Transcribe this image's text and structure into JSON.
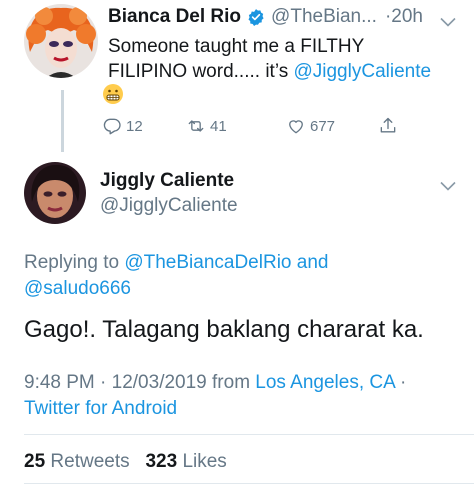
{
  "parent_tweet": {
    "name": "Bianca Del Rio",
    "handle": "@TheBian...",
    "time": "·20h",
    "text_line1": "Someone taught me a FILTHY",
    "text_line2_prefix": "FILIPINO word..... it’s ",
    "mention": "@JigglyCaliente",
    "emoji": "grimacing-face",
    "reply_count": "12",
    "retweet_count": "41",
    "like_count": "677"
  },
  "main_tweet": {
    "name": "Jiggly Caliente",
    "handle": "@JigglyCaliente",
    "replying_prefix": "Replying to ",
    "replying_to_1": "@TheBiancaDelRio",
    "replying_and": " and",
    "replying_to_2": "@saludo666",
    "text": "Gago!. Talagang baklang chararat ka.",
    "time_date": "9:48 PM · 12/03/2019 from ",
    "location": "Los Angeles, CA",
    "separator": " ·",
    "source": "Twitter for Android",
    "retweets_count": "25",
    "retweets_label": "Retweets",
    "likes_count": "323",
    "likes_label": "Likes"
  },
  "colors": {
    "accent": "#1b95e0",
    "muted": "#657786",
    "text": "#14171a",
    "divider": "#e1e8ed"
  }
}
